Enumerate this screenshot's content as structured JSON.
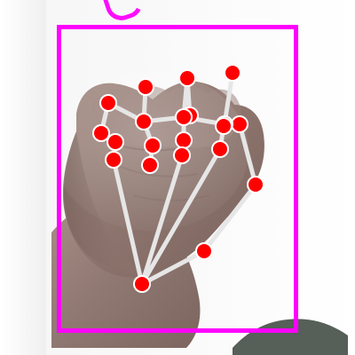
{
  "colors": {
    "bounding_box": "#ff00ff",
    "landmark": "#ff0000",
    "connection": "#e6e6e6",
    "background": "#f7f7f7"
  },
  "image": {
    "subject": "hand",
    "gesture": "closed fist",
    "annotations": {
      "bounding_box_visible": true,
      "landmark_count": 21,
      "connections_visible": true
    }
  }
}
